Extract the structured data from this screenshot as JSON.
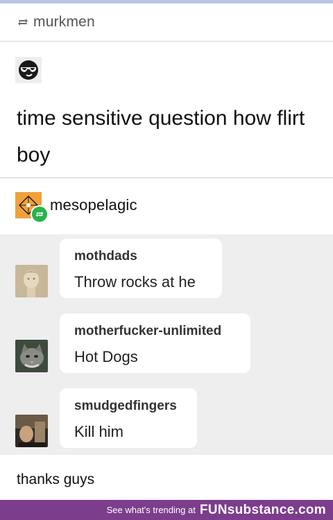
{
  "reblog_header": {
    "username": "murkmen",
    "icon": "reblog-icon"
  },
  "post": {
    "avatar_icon": "sunglasses-face-icon",
    "text": "time sensitive question how flirt boy"
  },
  "reblog": {
    "blog_name": "mesopelagic",
    "badge_icon": "reblog-icon",
    "badge_color": "#27b34b"
  },
  "replies": [
    {
      "username": "mothdads",
      "message": "Throw rocks at he"
    },
    {
      "username": "motherfucker-unlimited",
      "message": "Hot Dogs"
    },
    {
      "username": "smudgedfingers",
      "message": "Kill him"
    }
  ],
  "footer_text": "thanks guys",
  "banner": {
    "lead": "See what's trending at",
    "brand": "FUNsubstance.com",
    "color": "#7c3d8c"
  }
}
